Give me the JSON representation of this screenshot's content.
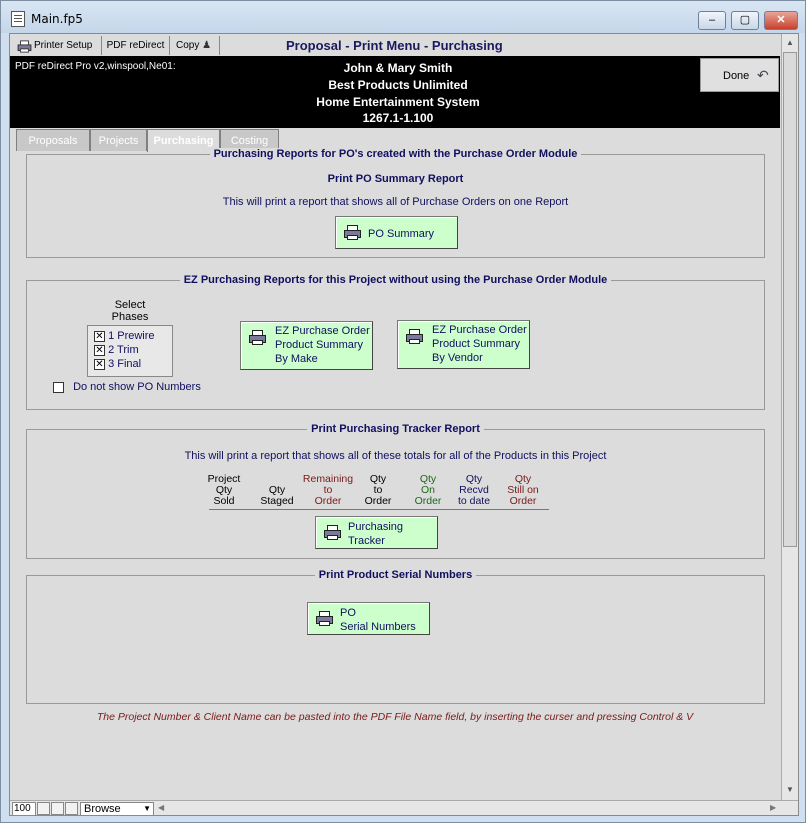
{
  "window": {
    "title": "Main.fp5",
    "min": "–",
    "max": "▢",
    "close": "✕"
  },
  "toolbar": {
    "printer_setup": "Printer Setup",
    "pdf_redirect": "PDF reDirect",
    "copy": "Copy",
    "title": "Proposal - Print Menu - Purchasing"
  },
  "header": {
    "pdf_driver": "PDF reDirect Pro v2,winspool,Ne01:",
    "client_name": "John & Mary Smith",
    "company": "Best Products Unlimited",
    "project_name": "Home Entertainment System",
    "project_number": "1267.1-1.100",
    "done": "Done"
  },
  "tabs": [
    {
      "label": "Proposals",
      "active": false
    },
    {
      "label": "Projects",
      "active": false
    },
    {
      "label": "Purchasing",
      "active": true
    },
    {
      "label": "Costing",
      "active": false
    }
  ],
  "po_module": {
    "title": "Purchasing Reports for PO's created with the Purchase Order Module",
    "subtitle": "Print PO Summary Report",
    "description": "This will print a report that shows all of Purchase Orders on one Report",
    "button": "PO Summary"
  },
  "ez": {
    "title": "EZ Purchasing Reports for this Project without using the Purchase Order Module",
    "select_label_1": "Select",
    "select_label_2": "Phases",
    "phases": [
      {
        "label": "1 Prewire",
        "checked": true
      },
      {
        "label": "2 Trim",
        "checked": true
      },
      {
        "label": "3 Final",
        "checked": true
      }
    ],
    "hide_po_numbers": {
      "label": "Do not show PO Numbers",
      "checked": false
    },
    "by_make": [
      "EZ Purchase Order",
      "Product Summary",
      "By Make"
    ],
    "by_vendor": [
      "EZ Purchase Order",
      "Product Summary",
      "By Vendor"
    ]
  },
  "tracker": {
    "title": "Print Purchasing Tracker Report",
    "description": "This will print a report that shows all of these totals for all of the Products in this Project",
    "columns": [
      {
        "lines": [
          "Project",
          "Qty",
          "Sold"
        ],
        "color": "#000000"
      },
      {
        "lines": [
          "Qty",
          "Staged"
        ],
        "color": "#000000"
      },
      {
        "lines": [
          "Remaining",
          "to",
          "Order"
        ],
        "color": "#7a1a1a"
      },
      {
        "lines": [
          "Qty",
          "to",
          "Order"
        ],
        "color": "#000000"
      },
      {
        "lines": [
          "Qty",
          "On",
          "Order"
        ],
        "color": "#1a6a1a"
      },
      {
        "lines": [
          "Qty",
          "Recvd",
          "to date"
        ],
        "color": "#101060"
      },
      {
        "lines": [
          "Qty",
          "Still on",
          "Order"
        ],
        "color": "#7a1a1a"
      }
    ],
    "button": [
      "Purchasing",
      "Tracker"
    ]
  },
  "serials": {
    "title": "Print Product Serial Numbers",
    "button": [
      "PO",
      "Serial Numbers"
    ]
  },
  "footnote": "The Project Number & Client Name can be pasted into the PDF File Name field, by inserting the curser and pressing Control & V",
  "statusbar": {
    "zoom": "100",
    "mode": "Browse"
  }
}
